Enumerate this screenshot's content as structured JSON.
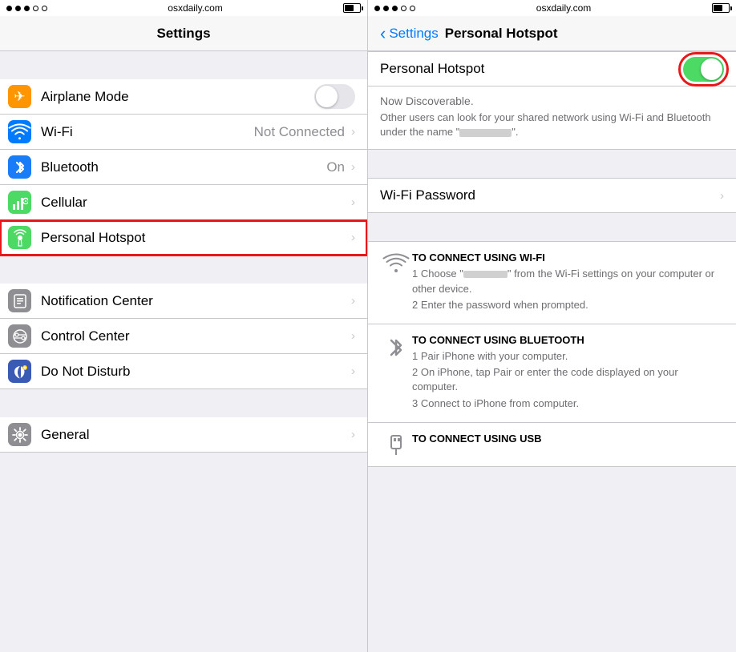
{
  "left": {
    "statusBar": {
      "dots": [
        "filled",
        "filled",
        "filled",
        "empty",
        "empty"
      ],
      "title": "osxdaily.com",
      "battery": 60
    },
    "navTitle": "Settings",
    "items": [
      {
        "id": "airplane-mode",
        "label": "Airplane Mode",
        "iconBg": "#ff9500",
        "iconSymbol": "✈",
        "value": "",
        "hasToggle": true,
        "hasChevron": false,
        "highlighted": false
      },
      {
        "id": "wifi",
        "label": "Wi-Fi",
        "iconBg": "#007aff",
        "iconSymbol": "wifi",
        "value": "Not Connected",
        "hasToggle": false,
        "hasChevron": true,
        "highlighted": false
      },
      {
        "id": "bluetooth",
        "label": "Bluetooth",
        "iconBg": "#1b7cf7",
        "iconSymbol": "bt",
        "value": "On",
        "hasToggle": false,
        "hasChevron": true,
        "highlighted": false
      },
      {
        "id": "cellular",
        "label": "Cellular",
        "iconBg": "#4cd964",
        "iconSymbol": "cellular",
        "value": "",
        "hasToggle": false,
        "hasChevron": true,
        "highlighted": false
      },
      {
        "id": "personal-hotspot",
        "label": "Personal Hotspot",
        "iconBg": "#4cd964",
        "iconSymbol": "hotspot",
        "value": "",
        "hasToggle": false,
        "hasChevron": true,
        "highlighted": true
      },
      {
        "id": "notification-center",
        "label": "Notification Center",
        "iconBg": "#8e8e93",
        "iconSymbol": "notif",
        "value": "",
        "hasToggle": false,
        "hasChevron": true,
        "highlighted": false
      },
      {
        "id": "control-center",
        "label": "Control Center",
        "iconBg": "#8e8e93",
        "iconSymbol": "control",
        "value": "",
        "hasToggle": false,
        "hasChevron": true,
        "highlighted": false
      },
      {
        "id": "do-not-disturb",
        "label": "Do Not Disturb",
        "iconBg": "#5856d6",
        "iconSymbol": "moon",
        "value": "",
        "hasToggle": false,
        "hasChevron": true,
        "highlighted": false
      },
      {
        "id": "general",
        "label": "General",
        "iconBg": "#8e8e93",
        "iconSymbol": "gear",
        "value": "",
        "hasToggle": false,
        "hasChevron": true,
        "highlighted": false
      }
    ]
  },
  "right": {
    "statusBar": {
      "dots": [
        "filled",
        "filled",
        "filled",
        "empty",
        "empty"
      ],
      "title": "osxdaily.com",
      "battery": 60
    },
    "backLabel": "Settings",
    "navTitle": "Personal Hotspot",
    "hotspotOn": true,
    "discoverableTitle": "Now Discoverable.",
    "discoverableText": "Other users can look for your shared network using Wi-Fi and Bluetooth under the name \"",
    "discoverableText2": "\".",
    "wifiPasswordLabel": "Wi-Fi Password",
    "connectSections": [
      {
        "id": "wifi-connect",
        "title": "TO CONNECT USING WI-FI",
        "steps": [
          "1 Choose \"                    \" from the Wi-Fi settings on your computer or other device.",
          "2 Enter the password when prompted."
        ]
      },
      {
        "id": "bt-connect",
        "title": "TO CONNECT USING BLUETOOTH",
        "steps": [
          "1 Pair iPhone with your computer.",
          "2 On iPhone, tap Pair or enter the code displayed on your computer.",
          "3 Connect to iPhone from computer."
        ]
      },
      {
        "id": "usb-connect",
        "title": "TO CONNECT USING USB",
        "steps": []
      }
    ]
  }
}
